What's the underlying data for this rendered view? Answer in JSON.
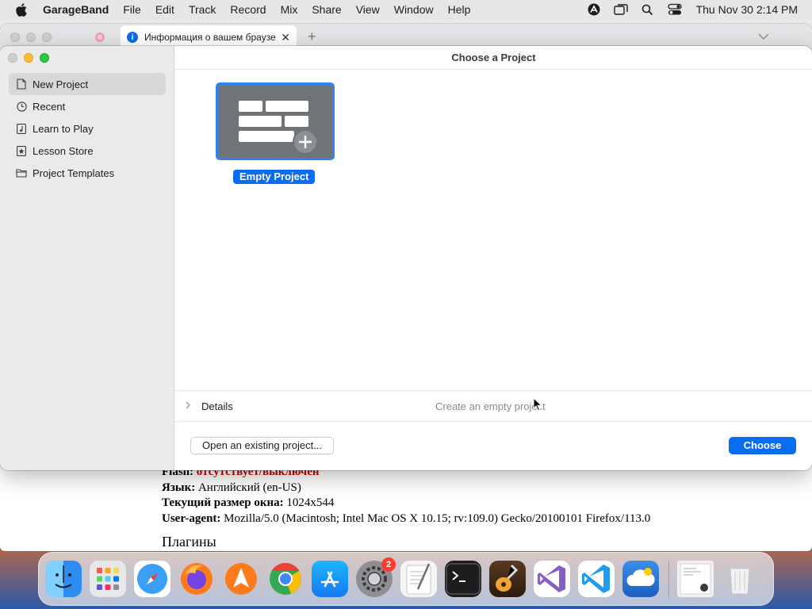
{
  "menubar": {
    "app_name": "GarageBand",
    "items": [
      "File",
      "Edit",
      "Track",
      "Record",
      "Mix",
      "Share",
      "View",
      "Window",
      "Help"
    ],
    "clock": "Thu Nov 30  2:14 PM",
    "status_icons": [
      "scrobbler-icon",
      "screen-mirroring-icon",
      "spotlight-search-icon",
      "control-center-icon"
    ]
  },
  "browser": {
    "tab_title": "Информация о вашем браузере",
    "info_rows": [
      {
        "label": "Flash:",
        "value": "отсутствует/выключен",
        "highlight": true
      },
      {
        "label": "Язык:",
        "value": "Английский (en-US)"
      },
      {
        "label": "Текущий размер окна:",
        "value": "1024x544"
      },
      {
        "label": "User-agent:",
        "value": "Mozilla/5.0 (Macintosh; Intel Mac OS X 10.15; rv:109.0) Gecko/20100101 Firefox/113.0"
      }
    ],
    "section_heading": "Плагины"
  },
  "garageband": {
    "window_title": "Choose a Project",
    "sidebar": [
      {
        "label": "New Project",
        "icon": "document-icon",
        "selected": true
      },
      {
        "label": "Recent",
        "icon": "clock-icon"
      },
      {
        "label": "Learn to Play",
        "icon": "music-note-icon"
      },
      {
        "label": "Lesson Store",
        "icon": "star-icon"
      },
      {
        "label": "Project Templates",
        "icon": "folder-icon"
      }
    ],
    "project_tile_label": "Empty Project",
    "details_label": "Details",
    "details_description": "Create an empty project",
    "open_button": "Open an existing project...",
    "choose_button": "Choose",
    "accent_color": "#0a6cf0"
  },
  "dock": {
    "apps": [
      "Finder",
      "Launchpad",
      "Safari",
      "Firefox",
      "Transmit",
      "Chrome",
      "App Store",
      "System Settings",
      "TextEdit",
      "Terminal",
      "GarageBand",
      "Visual Studio",
      "VS Code",
      "Cloud Drive",
      "Downloads",
      "Trash"
    ],
    "system_settings_badge": "2"
  }
}
